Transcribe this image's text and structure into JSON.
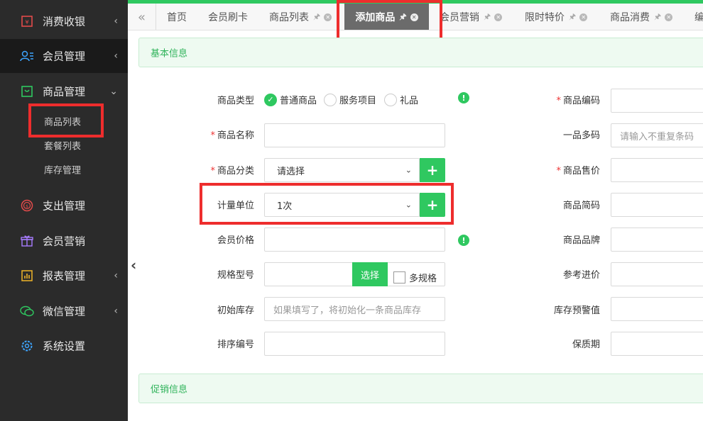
{
  "sidebar": {
    "items": [
      {
        "label": "消费收银",
        "arrow": "‹"
      },
      {
        "label": "会员管理",
        "arrow": "‹"
      },
      {
        "label": "商品管理",
        "arrow": "⌄"
      },
      {
        "label": "支出管理",
        "arrow": ""
      },
      {
        "label": "会员营销",
        "arrow": ""
      },
      {
        "label": "报表管理",
        "arrow": "‹"
      },
      {
        "label": "微信管理",
        "arrow": "‹"
      },
      {
        "label": "系统设置",
        "arrow": ""
      }
    ],
    "sub_items": [
      "商品列表",
      "套餐列表",
      "库存管理"
    ]
  },
  "tabs": {
    "back": "«",
    "items": [
      {
        "label": "首页"
      },
      {
        "label": "会员刷卡"
      },
      {
        "label": "商品列表"
      },
      {
        "label": "添加商品"
      },
      {
        "label": "会员营销"
      },
      {
        "label": "限时特价"
      },
      {
        "label": "商品消费"
      },
      {
        "label": "编"
      }
    ]
  },
  "sections": {
    "basic": "基本信息",
    "promo": "促销信息"
  },
  "form": {
    "type_label": "商品类型",
    "type_options": [
      "普通商品",
      "服务项目",
      "礼品"
    ],
    "name_label": "商品名称",
    "category_label": "商品分类",
    "category_value": "请选择",
    "unit_label": "计量单位",
    "unit_value": "1次",
    "member_price_label": "会员价格",
    "spec_label": "规格型号",
    "spec_button": "选择",
    "multi_spec": "多规格",
    "init_stock_label": "初始库存",
    "init_stock_placeholder": "如果填写了，将初始化一条商品库存",
    "sort_label": "排序编号",
    "code_label": "商品编码",
    "barcode_label": "一品多码",
    "barcode_placeholder": "请输入不重复条码",
    "price_label": "商品售价",
    "short_code_label": "商品简码",
    "brand_label": "商品品牌",
    "ref_price_label": "参考进价",
    "warn_label": "库存预警值",
    "shelf_label": "保质期",
    "required_mark": "*",
    "plus": "+",
    "info": "!"
  },
  "colors": {
    "accent": "#2fc860",
    "sidebar": "#2b2b2b",
    "highlight": "#ee2d2d"
  }
}
